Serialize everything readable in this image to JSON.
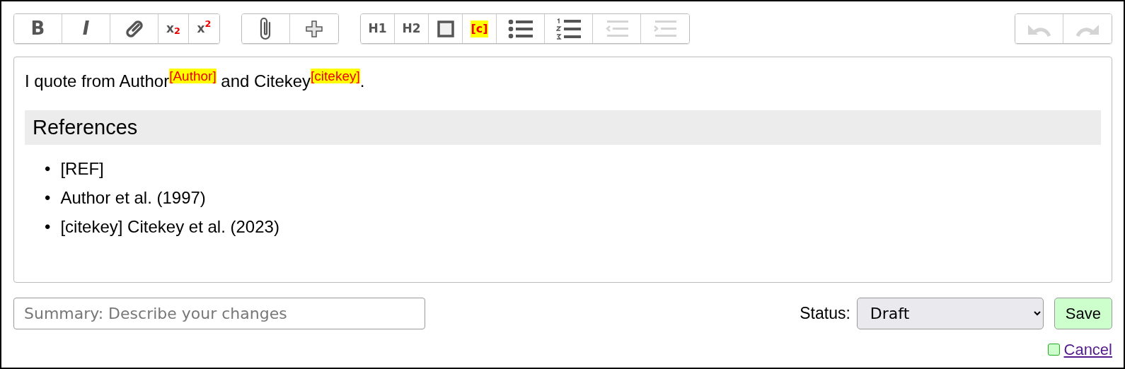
{
  "toolbar": {
    "groups": [
      {
        "buttons": [
          {
            "kind": "bold",
            "label": "B",
            "disabled": false
          },
          {
            "kind": "italic",
            "label": "I",
            "disabled": false
          },
          {
            "kind": "link",
            "disabled": false
          },
          {
            "kind": "sub",
            "label": "x",
            "script": "2",
            "disabled": false
          },
          {
            "kind": "sup",
            "label": "x",
            "script": "2",
            "disabled": false
          }
        ]
      },
      {
        "buttons": [
          {
            "kind": "attach",
            "disabled": false
          },
          {
            "kind": "plus",
            "disabled": false
          }
        ]
      },
      {
        "buttons": [
          {
            "kind": "heading",
            "label": "H1",
            "disabled": false
          },
          {
            "kind": "heading",
            "label": "H2",
            "disabled": false
          },
          {
            "kind": "frame",
            "disabled": false
          },
          {
            "kind": "cite",
            "label": "[c]",
            "disabled": false
          },
          {
            "kind": "bullets",
            "disabled": false
          },
          {
            "kind": "numbers",
            "disabled": false
          },
          {
            "kind": "outdent",
            "disabled": true
          },
          {
            "kind": "indent",
            "disabled": true
          }
        ]
      },
      {
        "buttons": [
          {
            "kind": "undo",
            "disabled": true
          },
          {
            "kind": "redo",
            "disabled": true
          }
        ]
      }
    ]
  },
  "editor": {
    "paragraph": "I quote from Author$^{[Author]}$ and Citekey$^{[citekey]}$.",
    "heading": "References",
    "references": [
      {
        "bullet": "•",
        "text": "[REF]"
      },
      {
        "bullet": "•",
        "text": "Author et al. (1997)"
      },
      {
        "bullet": "•",
        "text": "[citekey] Citekey et al. (2023)"
      }
    ]
  },
  "summary": {
    "placeholder": "Summary: Describe your changes"
  },
  "status": {
    "label": "Status:",
    "value": "Draft"
  },
  "save": {
    "label": "Save"
  },
  "cancel": {
    "label": "Cancel",
    "checked": false
  }
}
